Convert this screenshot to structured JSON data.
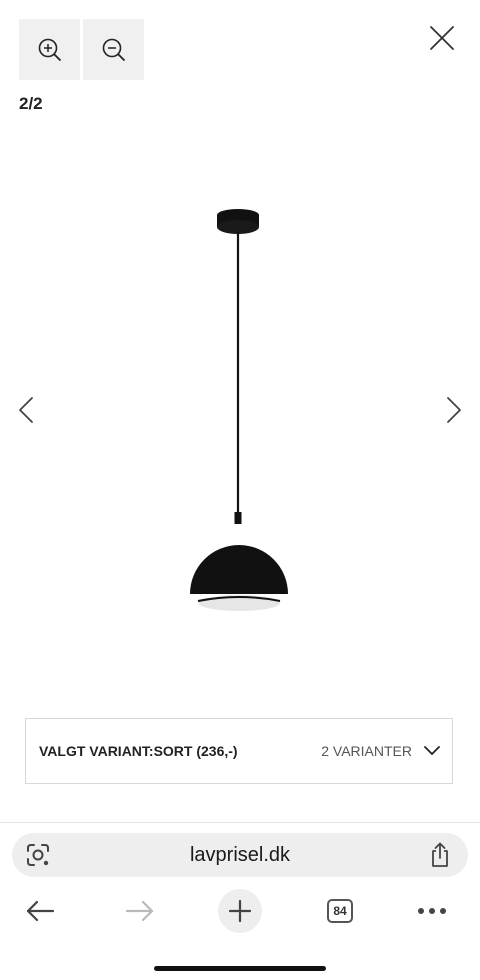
{
  "viewer": {
    "counter": "2/2"
  },
  "variant": {
    "selected_label": "VALGT VARIANT:SORT (236,-)",
    "count_label": "2 VARIANTER"
  },
  "browser": {
    "url": "lavprisel.dk",
    "tab_count": "84"
  },
  "icons": {
    "zoom_in": "zoom-in-icon",
    "zoom_out": "zoom-out-icon",
    "close": "close-icon",
    "prev": "chevron-left-icon",
    "next": "chevron-right-icon",
    "dropdown": "chevron-down-icon",
    "lens": "lens-icon",
    "share": "share-icon",
    "back": "arrow-left-icon",
    "forward": "arrow-right-icon",
    "new_tab": "plus-icon",
    "more": "more-icon"
  },
  "colors": {
    "lamp": "#111111",
    "lamp_inner": "#e6e6e6",
    "forward_disabled": "#b9b9b9"
  }
}
